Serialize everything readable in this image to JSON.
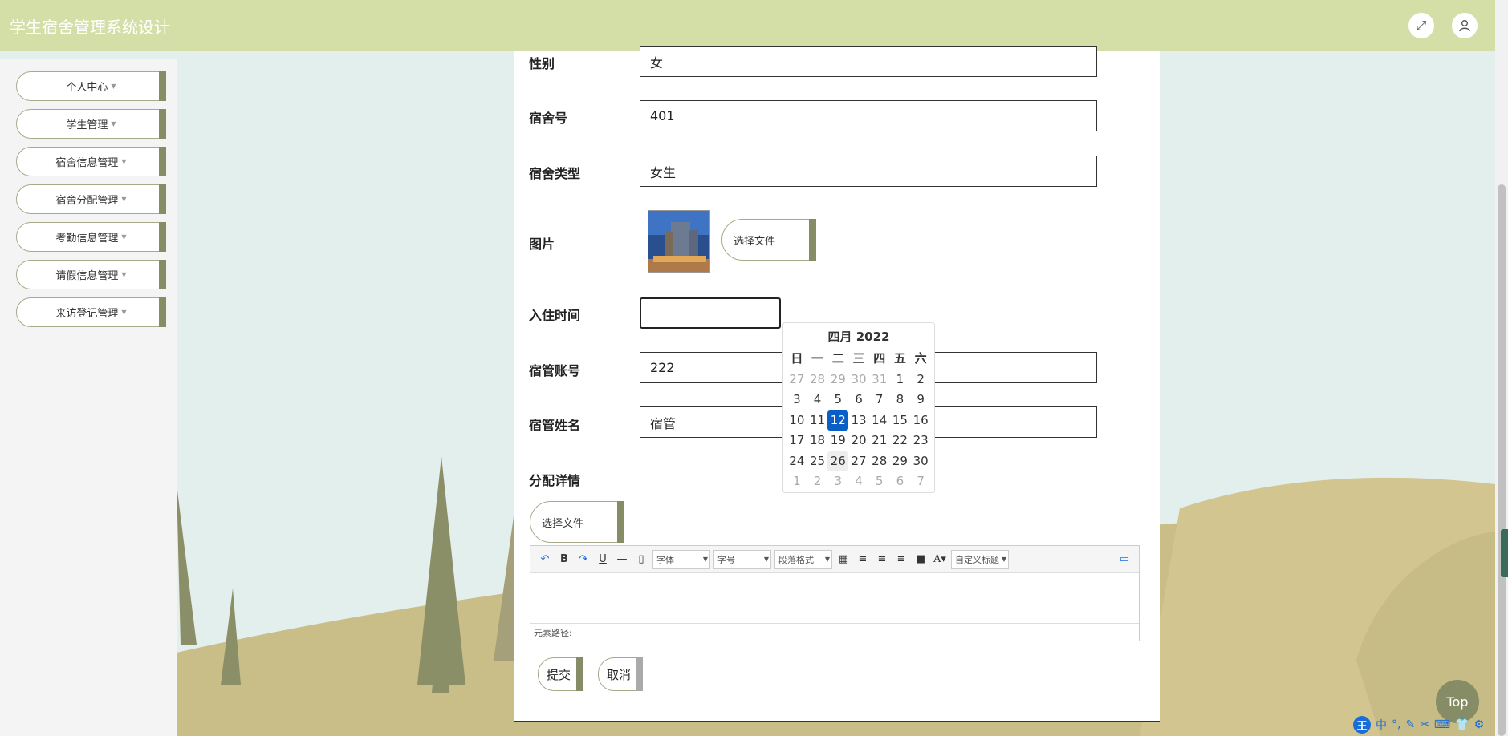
{
  "header": {
    "title": "学生宿舍管理系统设计"
  },
  "sidebar": {
    "items": [
      {
        "label": "个人中心"
      },
      {
        "label": "学生管理"
      },
      {
        "label": "宿舍信息管理"
      },
      {
        "label": "宿舍分配管理"
      },
      {
        "label": "考勤信息管理"
      },
      {
        "label": "请假信息管理"
      },
      {
        "label": "来访登记管理"
      }
    ]
  },
  "form": {
    "gender": {
      "label": "性别",
      "value": "女"
    },
    "dorm_no": {
      "label": "宿舍号",
      "value": "401"
    },
    "dorm_type": {
      "label": "宿舍类型",
      "value": "女生"
    },
    "picture": {
      "label": "图片",
      "button": "选择文件"
    },
    "checkin_time": {
      "label": "入住时间",
      "value": ""
    },
    "manager_account": {
      "label": "宿管账号",
      "value": "222"
    },
    "manager_name": {
      "label": "宿管姓名",
      "value": "宿管"
    },
    "detail": {
      "label": "分配详情",
      "button": "选择文件"
    },
    "submit": "提交",
    "cancel": "取消"
  },
  "editor": {
    "font": "字体",
    "size": "字号",
    "paragraph": "段落格式",
    "custom_title": "自定义标题",
    "path_label": "元素路径:"
  },
  "datepicker": {
    "header": "四月 2022",
    "weekdays": [
      "日",
      "一",
      "二",
      "三",
      "四",
      "五",
      "六"
    ],
    "rows": [
      [
        "27",
        "28",
        "29",
        "30",
        "31",
        "1",
        "2"
      ],
      [
        "3",
        "4",
        "5",
        "6",
        "7",
        "8",
        "9"
      ],
      [
        "10",
        "11",
        "12",
        "13",
        "14",
        "15",
        "16"
      ],
      [
        "17",
        "18",
        "19",
        "20",
        "21",
        "22",
        "23"
      ],
      [
        "24",
        "25",
        "26",
        "27",
        "28",
        "29",
        "30"
      ],
      [
        "1",
        "2",
        "3",
        "4",
        "5",
        "6",
        "7"
      ]
    ],
    "selected": "12"
  },
  "top_button": "Top",
  "ime": {
    "logo": "王",
    "lang": "中"
  },
  "colors": {
    "header": "#d4dfa8",
    "accent": "#868d66",
    "selected": "#0a5fc6"
  }
}
